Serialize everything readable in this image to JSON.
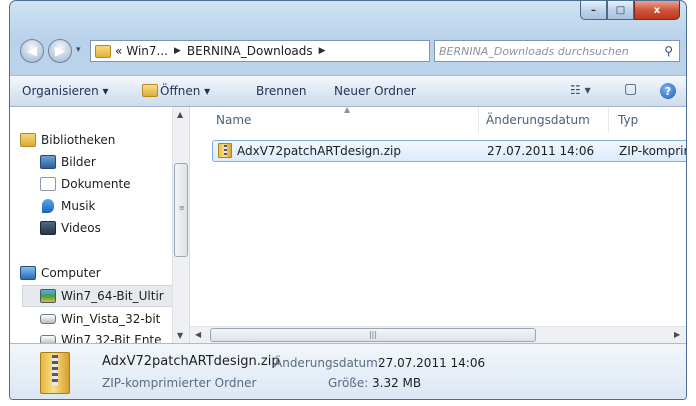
{
  "window": {
    "caption": {
      "minimize": "–",
      "maximize": "□",
      "close": "x"
    }
  },
  "address_bar": {
    "overflow": "«",
    "crumbs": [
      "Win7...",
      "BERNINA_Downloads"
    ],
    "search_placeholder": "BERNINA_Downloads durchsuchen"
  },
  "toolbar": {
    "organize": "Organisieren ▾",
    "open": "Öffnen ▾",
    "burn": "Brennen",
    "new_folder": "Neuer Ordner",
    "view_options": "☷ ▾",
    "preview_pane": "▢",
    "help": "?"
  },
  "navigation": {
    "items": [
      {
        "label": "Bibliotheken",
        "icon": "library-icon"
      },
      {
        "label": "Bilder",
        "icon": "pictures-icon"
      },
      {
        "label": "Dokumente",
        "icon": "documents-icon"
      },
      {
        "label": "Musik",
        "icon": "music-icon"
      },
      {
        "label": "Videos",
        "icon": "videos-icon"
      },
      {
        "label": "Computer",
        "icon": "computer-icon"
      },
      {
        "label": "Win7_64-Bit_Ultir",
        "icon": "windows-drive-icon"
      },
      {
        "label": "Win_Vista_32-bit",
        "icon": "drive-icon"
      },
      {
        "label": "Win7 32-Bit Ente",
        "icon": "drive-icon"
      }
    ]
  },
  "file_list": {
    "columns": [
      "Name",
      "Änderungsdatum",
      "Typ"
    ],
    "rows": [
      {
        "name": "AdxV72patchARTdesign.zip",
        "date": "27.07.2011 14:06",
        "type": "ZIP-komprim"
      }
    ]
  },
  "details_pane": {
    "file_name": "AdxV72patchARTdesign.zip",
    "date_label": "Änderungsdatum:",
    "date_value": "27.07.2011 14:06",
    "type_value": "ZIP-komprimierter Ordner",
    "size_label": "Größe:",
    "size_value": "3.32 MB"
  },
  "colors": {
    "frame": "#b9d2ea",
    "selection": "#dcebfc",
    "close_button": "#cf553b"
  }
}
